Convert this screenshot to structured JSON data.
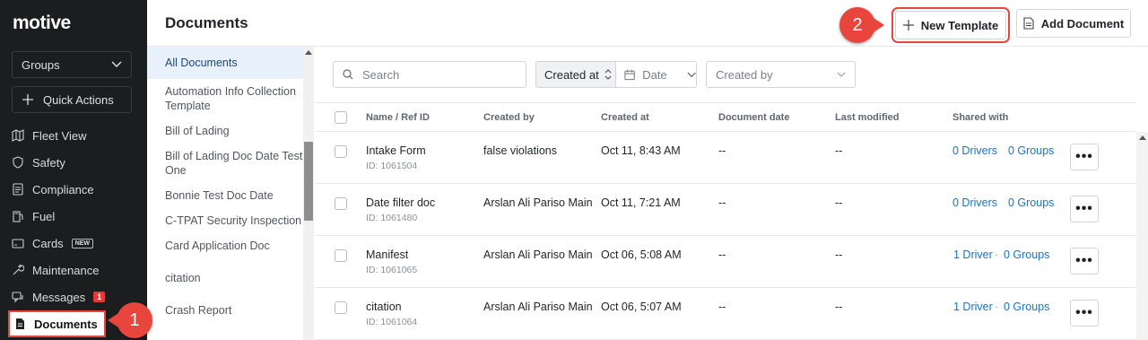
{
  "brand": {
    "logo_text": "motive"
  },
  "sidebar": {
    "groups_label": "Groups",
    "quick_actions_label": "Quick Actions",
    "items": [
      {
        "label": "Fleet View",
        "icon": "map-icon"
      },
      {
        "label": "Safety",
        "icon": "shield-icon"
      },
      {
        "label": "Compliance",
        "icon": "document-list-icon"
      },
      {
        "label": "Fuel",
        "icon": "fuel-icon"
      },
      {
        "label": "Cards",
        "icon": "card-icon",
        "badge": "NEW"
      },
      {
        "label": "Maintenance",
        "icon": "wrench-icon"
      },
      {
        "label": "Messages",
        "icon": "chat-icon",
        "count": "1"
      },
      {
        "label": "Documents",
        "icon": "file-icon",
        "active": true
      }
    ]
  },
  "callouts": {
    "one": "1",
    "two": "2"
  },
  "header": {
    "title": "Documents",
    "new_template_label": "New Template",
    "add_document_label": "Add Document"
  },
  "templates": [
    "All Documents",
    "Automation Info Collection Template",
    "Bill of Lading",
    "Bill of Lading Doc Date Test One",
    "Bonnie Test Doc Date",
    "C-TPAT Security Inspection",
    "Card Application Doc",
    "citation",
    "Crash Report"
  ],
  "filters": {
    "search_placeholder": "Search",
    "sort_label": "Created at",
    "date_label": "Date",
    "created_by_label": "Created by"
  },
  "table": {
    "columns": [
      "Name / Ref ID",
      "Created by",
      "Created at",
      "Document date",
      "Last modified",
      "Shared with"
    ],
    "rows": [
      {
        "name": "Intake Form",
        "ref": "ID: 1061504",
        "created_by": "false violations",
        "created_at": "Oct 11, 8:43 AM",
        "doc_date": "--",
        "modified": "--",
        "drivers": "0 Drivers",
        "sep": "",
        "groups": "0 Groups"
      },
      {
        "name": "Date filter doc",
        "ref": "ID: 1061480",
        "created_by": "Arslan Ali Pariso Main",
        "created_at": "Oct 11, 7:21 AM",
        "doc_date": "--",
        "modified": "--",
        "drivers": "0 Drivers",
        "sep": "",
        "groups": "0 Groups"
      },
      {
        "name": "Manifest",
        "ref": "ID: 1061065",
        "created_by": "Arslan Ali Pariso Main",
        "created_at": "Oct 06, 5:08 AM",
        "doc_date": "--",
        "modified": "--",
        "drivers": "1 Driver",
        "sep": "·",
        "groups": "0 Groups"
      },
      {
        "name": "citation",
        "ref": "ID: 1061064",
        "created_by": "Arslan Ali Pariso Main",
        "created_at": "Oct 06, 5:07 AM",
        "doc_date": "--",
        "modified": "--",
        "drivers": "1 Driver",
        "sep": "·",
        "groups": "0 Groups"
      }
    ],
    "more_label": "•••"
  }
}
